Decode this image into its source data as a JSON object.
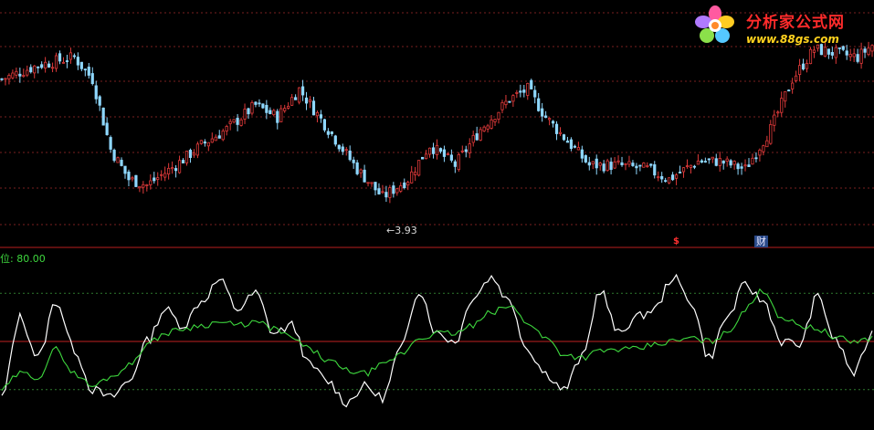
{
  "chart_data": [
    {
      "type": "candlestick",
      "title": "",
      "ylim": [
        3.75,
        4.9
      ],
      "grid": true,
      "up_color": "#e03a3a",
      "down_color": "#8fd8ff",
      "annotation_low": "←3.93",
      "markers": [
        "$",
        "财"
      ],
      "approx_close_path": [
        {
          "bar": 0,
          "close": 4.55
        },
        {
          "bar": 10,
          "close": 4.62
        },
        {
          "bar": 20,
          "close": 4.66
        },
        {
          "bar": 25,
          "close": 4.55
        },
        {
          "bar": 30,
          "close": 4.2
        },
        {
          "bar": 35,
          "close": 4.05
        },
        {
          "bar": 40,
          "close": 4.02
        },
        {
          "bar": 48,
          "close": 4.12
        },
        {
          "bar": 55,
          "close": 4.22
        },
        {
          "bar": 62,
          "close": 4.3
        },
        {
          "bar": 70,
          "close": 4.42
        },
        {
          "bar": 76,
          "close": 4.36
        },
        {
          "bar": 82,
          "close": 4.5
        },
        {
          "bar": 90,
          "close": 4.3
        },
        {
          "bar": 98,
          "close": 4.1
        },
        {
          "bar": 105,
          "close": 3.96
        },
        {
          "bar": 112,
          "close": 4.05
        },
        {
          "bar": 118,
          "close": 4.22
        },
        {
          "bar": 125,
          "close": 4.12
        },
        {
          "bar": 132,
          "close": 4.3
        },
        {
          "bar": 140,
          "close": 4.45
        },
        {
          "bar": 145,
          "close": 4.5
        },
        {
          "bar": 150,
          "close": 4.36
        },
        {
          "bar": 156,
          "close": 4.24
        },
        {
          "bar": 162,
          "close": 4.12
        },
        {
          "bar": 170,
          "close": 4.12
        },
        {
          "bar": 178,
          "close": 4.1
        },
        {
          "bar": 184,
          "close": 4.05
        },
        {
          "bar": 192,
          "close": 4.14
        },
        {
          "bar": 198,
          "close": 4.14
        },
        {
          "bar": 205,
          "close": 4.1
        },
        {
          "bar": 212,
          "close": 4.3
        },
        {
          "bar": 218,
          "close": 4.55
        },
        {
          "bar": 224,
          "close": 4.7
        },
        {
          "bar": 230,
          "close": 4.68
        },
        {
          "bar": 236,
          "close": 4.66
        },
        {
          "bar": 240,
          "close": 4.72
        }
      ]
    },
    {
      "type": "line",
      "title": "",
      "level_label": "位: 80.00",
      "ylim": [
        0,
        100
      ],
      "hlines": [
        {
          "value": 80,
          "style": "dotted"
        },
        {
          "value": 50,
          "style": "solid"
        },
        {
          "value": 20,
          "style": "dotted"
        }
      ],
      "series": [
        {
          "color": "#ffffff",
          "points": [
            [
              0,
              15
            ],
            [
              5,
              65
            ],
            [
              10,
              40
            ],
            [
              15,
              75
            ],
            [
              20,
              45
            ],
            [
              25,
              20
            ],
            [
              30,
              15
            ],
            [
              35,
              25
            ],
            [
              40,
              50
            ],
            [
              45,
              70
            ],
            [
              50,
              60
            ],
            [
              55,
              75
            ],
            [
              60,
              88
            ],
            [
              65,
              70
            ],
            [
              70,
              80
            ],
            [
              75,
              55
            ],
            [
              80,
              60
            ],
            [
              85,
              35
            ],
            [
              90,
              25
            ],
            [
              95,
              12
            ],
            [
              100,
              22
            ],
            [
              105,
              15
            ],
            [
              110,
              45
            ],
            [
              115,
              82
            ],
            [
              120,
              55
            ],
            [
              125,
              50
            ],
            [
              130,
              78
            ],
            [
              135,
              90
            ],
            [
              140,
              75
            ],
            [
              145,
              45
            ],
            [
              150,
              30
            ],
            [
              155,
              20
            ],
            [
              160,
              40
            ],
            [
              165,
              82
            ],
            [
              170,
              55
            ],
            [
              175,
              65
            ],
            [
              180,
              70
            ],
            [
              185,
              90
            ],
            [
              190,
              75
            ],
            [
              195,
              40
            ],
            [
              200,
              65
            ],
            [
              205,
              85
            ],
            [
              210,
              75
            ],
            [
              215,
              50
            ],
            [
              220,
              48
            ],
            [
              225,
              78
            ],
            [
              230,
              50
            ],
            [
              235,
              30
            ],
            [
              240,
              55
            ]
          ]
        },
        {
          "color": "#3ed83e",
          "points": [
            [
              0,
              20
            ],
            [
              5,
              30
            ],
            [
              10,
              28
            ],
            [
              15,
              45
            ],
            [
              20,
              30
            ],
            [
              25,
              22
            ],
            [
              30,
              28
            ],
            [
              35,
              35
            ],
            [
              40,
              48
            ],
            [
              45,
              55
            ],
            [
              50,
              58
            ],
            [
              55,
              60
            ],
            [
              60,
              62
            ],
            [
              65,
              60
            ],
            [
              70,
              62
            ],
            [
              75,
              58
            ],
            [
              80,
              52
            ],
            [
              85,
              45
            ],
            [
              90,
              38
            ],
            [
              95,
              32
            ],
            [
              100,
              30
            ],
            [
              105,
              35
            ],
            [
              110,
              42
            ],
            [
              115,
              52
            ],
            [
              120,
              55
            ],
            [
              125,
              55
            ],
            [
              130,
              60
            ],
            [
              135,
              68
            ],
            [
              140,
              72
            ],
            [
              145,
              62
            ],
            [
              150,
              52
            ],
            [
              155,
              42
            ],
            [
              160,
              40
            ],
            [
              165,
              44
            ],
            [
              170,
              45
            ],
            [
              175,
              45
            ],
            [
              180,
              48
            ],
            [
              185,
              50
            ],
            [
              190,
              52
            ],
            [
              195,
              50
            ],
            [
              200,
              55
            ],
            [
              205,
              70
            ],
            [
              210,
              82
            ],
            [
              215,
              65
            ],
            [
              220,
              60
            ],
            [
              225,
              58
            ],
            [
              230,
              52
            ],
            [
              235,
              50
            ],
            [
              240,
              52
            ]
          ]
        }
      ]
    }
  ],
  "logo": {
    "title": "分析家公式网",
    "url": "www.88gs.com"
  },
  "colors": {
    "background": "#000000",
    "separator": "#b81e1e",
    "grid": "#7a2020",
    "osc_grid": "#2f7a2f",
    "osc_mid": "#c02222",
    "white_line": "#ffffff",
    "green_line": "#3ed83e"
  }
}
